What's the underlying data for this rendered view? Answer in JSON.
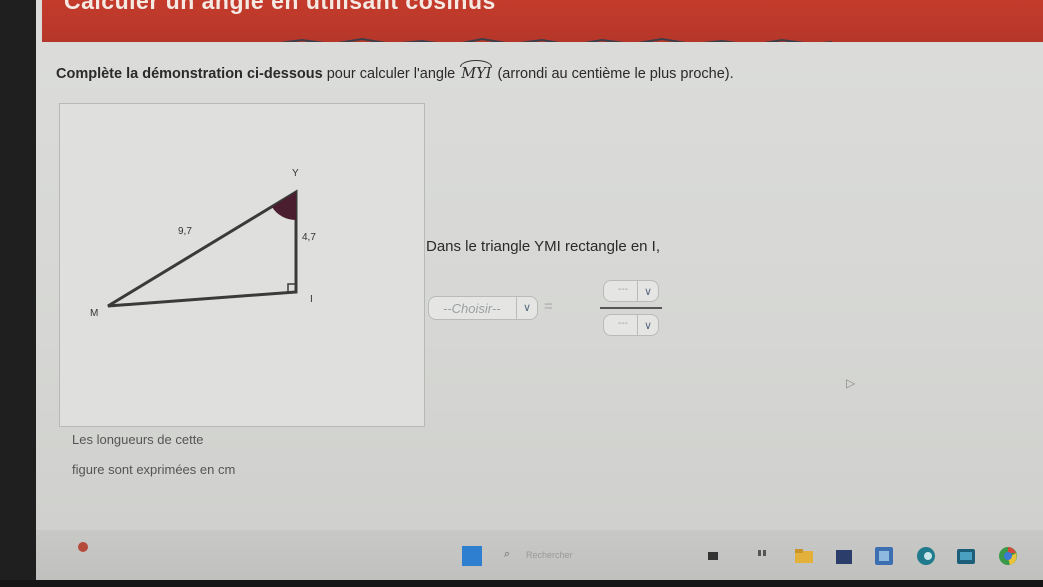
{
  "header": {
    "title": "Calculer un angle en utilisant cosinus"
  },
  "instruction": {
    "bold": "Complète la démonstration ci-dessous",
    "rest_before": " pour calculer l'angle ",
    "angle": "MYI",
    "rest_after": " (arrondi au centième le plus proche)."
  },
  "figure": {
    "vertex_y": "Y",
    "vertex_m": "M",
    "vertex_i": "I",
    "hypotenuse": "9,7",
    "side_yi": "4,7",
    "caption_line1": "Les longueurs de cette",
    "caption_line2": "figure sont exprimées en cm"
  },
  "demo": {
    "context": "Dans le triangle YMI rectangle en I,",
    "trig_select": "--Choisir--",
    "equals": "=",
    "numerator_select": "---",
    "denominator_select": "---",
    "arrow": "∨"
  },
  "taskbar": {
    "search_placeholder": "Rechercher"
  },
  "colors": {
    "header_red": "#c43b2c",
    "angle_fill": "#4a1e2e"
  }
}
